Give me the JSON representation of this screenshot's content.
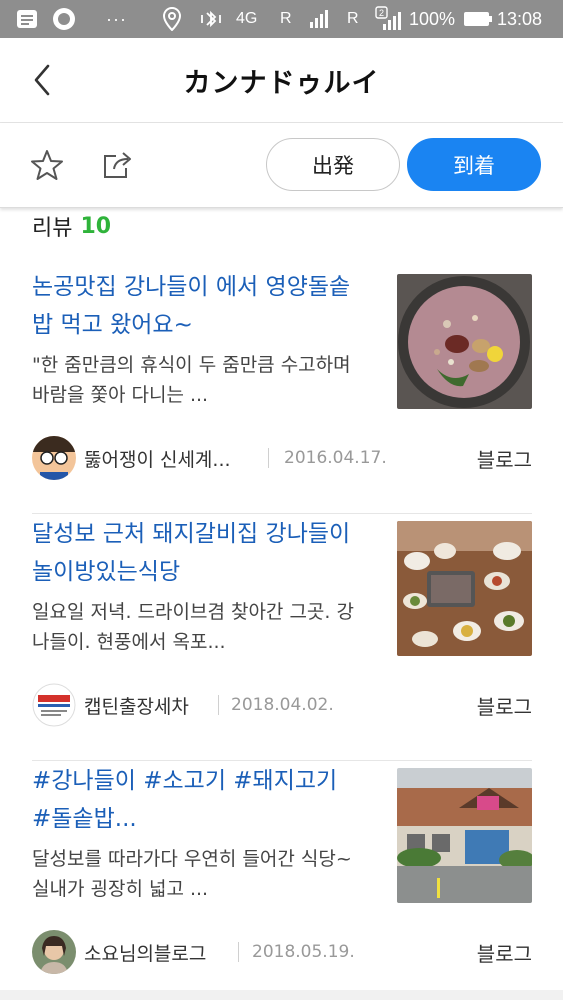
{
  "status_bar": {
    "dots": "···",
    "network": "4G",
    "roaming1": "R",
    "roaming2": "R",
    "sim2": "2",
    "battery_pct": "100%",
    "time": "13:08"
  },
  "header": {
    "title": "カンナドゥルイ"
  },
  "actions": {
    "depart_label": "出発",
    "arrive_label": "到着",
    "colors": {
      "arrive_bg": "#1a84f2"
    }
  },
  "reviews": {
    "label": "리뷰",
    "count": "10",
    "count_color": "#2fb33a",
    "items": [
      {
        "title": "논공맛집 강나들이 에서 영양돌솥밥 먹고 왔어요~",
        "snippet": "\"한 줌만큼의 휴식이 두 줌만큼 수고하며 바람을 쫓아 다니는 ...",
        "author": "뚫어쟁이 신세계...",
        "date": "2016.04.17.",
        "source": "블로그"
      },
      {
        "title": "달성보 근처 돼지갈비집 강나들이 놀이방있는식당",
        "snippet": "일요일 저녁. 드라이브겸 찾아간 그곳. 강나들이. 현풍에서 옥포...",
        "author": "캡틴출장세차",
        "date": "2018.04.02.",
        "source": "블로그"
      },
      {
        "title": "#강나들이 #소고기 #돼지고기 #돌솥밥...",
        "snippet": "달성보를 따라가다 우연히 들어간 식당~ 실내가 굉장히 넓고 ...",
        "author": "소요님의블로그",
        "date": "2018.05.19.",
        "source": "블로그"
      }
    ]
  }
}
